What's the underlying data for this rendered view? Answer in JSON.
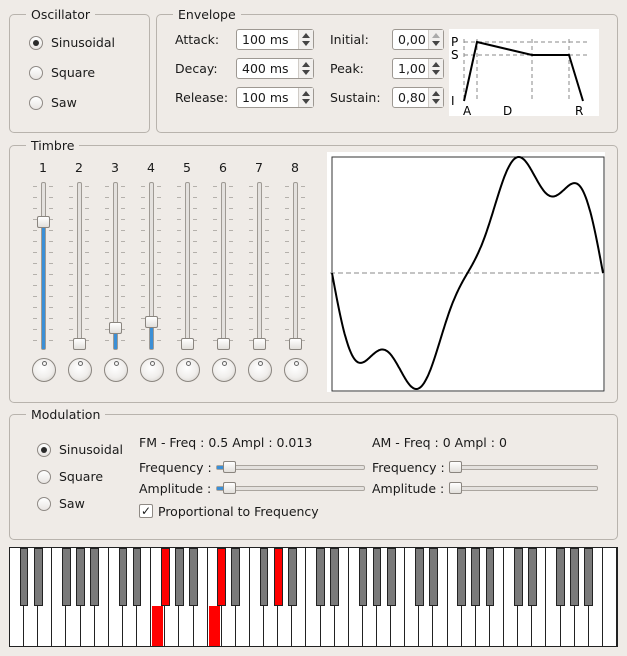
{
  "oscillator": {
    "title": "Oscillator",
    "options": [
      "Sinusoidal",
      "Square",
      "Saw"
    ],
    "selected": "Sinusoidal"
  },
  "envelope": {
    "title": "Envelope",
    "attack_label": "Attack:",
    "attack_value": "100 ms",
    "decay_label": "Decay:",
    "decay_value": "400 ms",
    "release_label": "Release:",
    "release_value": "100 ms",
    "initial_label": "Initial:",
    "initial_value": "0,00",
    "peak_label": "Peak:",
    "peak_value": "1,00",
    "sustain_label": "Sustain:",
    "sustain_value": "0,80",
    "diagram": {
      "y_labels": [
        "P",
        "S",
        "I"
      ],
      "x_labels": [
        "A",
        "D",
        "R"
      ]
    }
  },
  "timbre": {
    "title": "Timbre",
    "harmonics": [
      {
        "label": "1",
        "level": 0.78
      },
      {
        "label": "2",
        "level": 0.0
      },
      {
        "label": "3",
        "level": 0.1
      },
      {
        "label": "4",
        "level": 0.14
      },
      {
        "label": "5",
        "level": 0.0
      },
      {
        "label": "6",
        "level": 0.0
      },
      {
        "label": "7",
        "level": 0.0
      },
      {
        "label": "8",
        "level": 0.0
      }
    ]
  },
  "modulation": {
    "title": "Modulation",
    "options": [
      "Sinusoidal",
      "Square",
      "Saw"
    ],
    "selected": "Sinusoidal",
    "fm_status": "FM - Freq : 0.5 Ampl : 0.013",
    "am_status": "AM - Freq : 0 Ampl : 0",
    "fm_frequency_label": "Frequency :",
    "fm_amplitude_label": "Amplitude :",
    "am_frequency_label": "Frequency :",
    "am_amplitude_label": "Amplitude :",
    "fm_frequency_level": 0.05,
    "fm_amplitude_level": 0.05,
    "am_frequency_level": 0.0,
    "am_amplitude_level": 0.0,
    "proportional_label": "Proportional to Frequency",
    "proportional_checked": true
  },
  "keyboard": {
    "white_key_count": 43,
    "pressed_white_keys": [
      10,
      14
    ],
    "pressed_black_keys": [
      7,
      10,
      13
    ],
    "pressed_color": "#ff0000",
    "black_key_color": "#7a7a7a"
  },
  "colors": {
    "accent": "#3b8fd6",
    "window": "#efebe7"
  }
}
